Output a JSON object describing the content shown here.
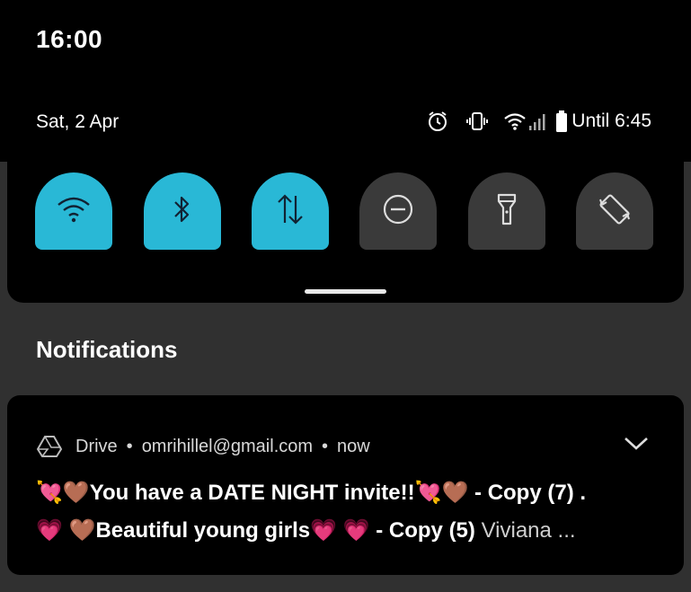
{
  "status_bar": {
    "time": "16:00",
    "date": "Sat, 2 Apr",
    "battery_text": "Until 6:45",
    "icons": [
      "alarm-icon",
      "vibrate-icon",
      "wifi-icon",
      "signal-icon",
      "battery-icon"
    ]
  },
  "quick_settings": {
    "tiles": [
      {
        "name": "wifi",
        "icon": "wifi-icon",
        "state": "on"
      },
      {
        "name": "bluetooth",
        "icon": "bluetooth-icon",
        "state": "on"
      },
      {
        "name": "mobile-data",
        "icon": "data-arrows-icon",
        "state": "on"
      },
      {
        "name": "do-not-disturb",
        "icon": "dnd-icon",
        "state": "off"
      },
      {
        "name": "flashlight",
        "icon": "flashlight-icon",
        "state": "off"
      },
      {
        "name": "auto-rotate",
        "icon": "rotate-icon",
        "state": "off"
      }
    ],
    "accent_color": "#29b8d6"
  },
  "notifications": {
    "heading": "Notifications",
    "items": [
      {
        "app": "Drive",
        "account": "omrihillel@gmail.com",
        "time": "now",
        "line1": {
          "prefix_emoji": "💘🤎",
          "text": "You have a DATE NIGHT invite!!",
          "mid_emoji": "💘🤎",
          "suffix": "- Copy (7) ."
        },
        "line2": {
          "prefix_emoji": "💗 🤎",
          "text": "Beautiful young girls",
          "mid_emoji": "💗 💗",
          "suffix": "- Copy (5)",
          "tail": "Viviana ..."
        }
      }
    ]
  }
}
